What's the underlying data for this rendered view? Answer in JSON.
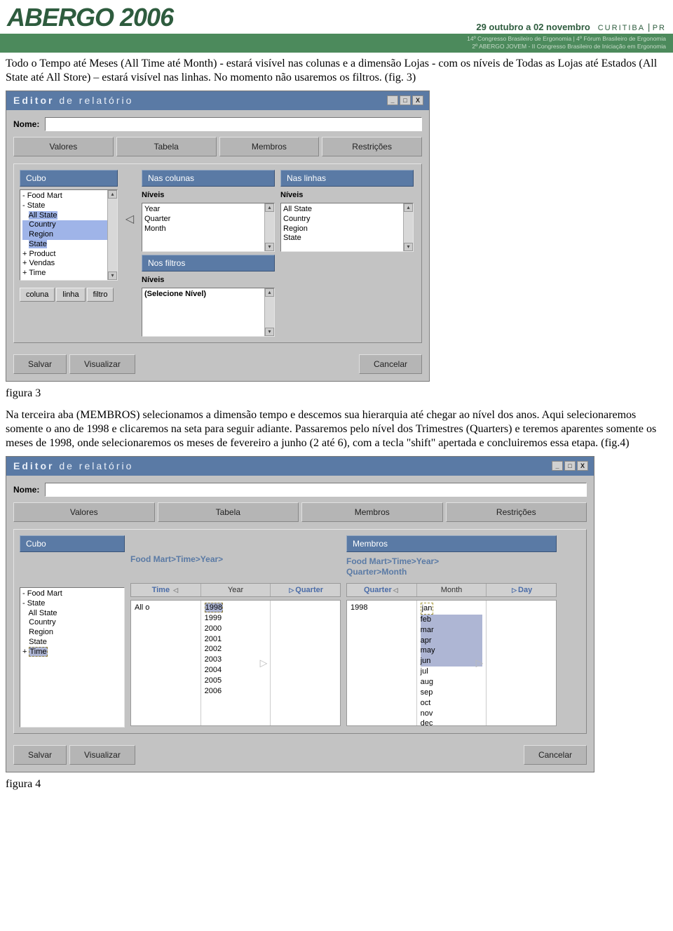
{
  "banner": {
    "title": "ABERGO 2006",
    "date_prefix": "29 outubro a 02 novembro",
    "city": "CURITIBA",
    "sep": "|",
    "state": "PR",
    "sub1": "14º Congresso Brasileiro de Ergonomia | 4º Fórum Brasileiro de Ergonomia",
    "sub2": "2º ABERGO JOVEM - II Congresso Brasileiro de Iniciação em Ergonomia"
  },
  "para1": "Todo o Tempo até Meses (All Time até Month) - estará visível nas colunas e a dimensão Lojas - com os níveis de Todas as Lojas até Estados (All State até All Store) – estará visível nas linhas. No momento não usaremos os filtros. (fig. 3)",
  "caption1": "figura 3",
  "para2": "Na terceira aba (MEMBROS) selecionamos a dimensão tempo e descemos sua hierarquia até chegar ao nível dos anos. Aqui selecionaremos somente o ano de 1998 e clicaremos na seta para seguir adiante. Passaremos pelo nível dos Trimestres (Quarters) e teremos aparentes somente os meses de 1998, onde selecionaremos os meses de fevereiro a junho (2 até 6), com a tecla \"shift\" apertada e concluiremos essa etapa. (fig.4)",
  "caption2": "figura 4",
  "editor": {
    "title_prefix": "Editor",
    "title_rest": " de relatório",
    "nome_label": "Nome:",
    "tabs": [
      "Valores",
      "Tabela",
      "Membros",
      "Restrições"
    ],
    "cube_header": "Cubo",
    "cols_header": "Nas colunas",
    "rows_header": "Nas linhas",
    "filters_header": "Nos filtros",
    "members_header": "Membros",
    "niveis": "Níveis",
    "tree": [
      "- Food Mart",
      "- State",
      "   All State",
      "   Country",
      "   Region",
      "   State",
      "+ Product",
      "+ Vendas",
      "+ Time"
    ],
    "tree2": [
      "- Food Mart",
      "- State",
      "   All State",
      "   Country",
      "   Region",
      "   State",
      "+ Time"
    ],
    "col_levels": [
      "Year",
      "Quarter",
      "Month"
    ],
    "row_levels": [
      "All State",
      "Country",
      "Region",
      "State"
    ],
    "filter_placeholder": "(Selecione Nível)",
    "small_btns": [
      "coluna",
      "linha",
      "filtro"
    ],
    "save": "Salvar",
    "view": "Visualizar",
    "cancel": "Cancelar",
    "bc1": "Food Mart>Time>Year>",
    "bc2a": "Food Mart>Time>Year>",
    "bc2b": "Quarter>Month",
    "nav1": [
      "Time",
      "Year",
      "Quarter"
    ],
    "nav2": [
      "Quarter",
      "Month",
      "Day"
    ],
    "allo": "All o",
    "years": [
      "1998",
      "1999",
      "2000",
      "2001",
      "2002",
      "2003",
      "2004",
      "2005",
      "2006"
    ],
    "y1998": "1998",
    "months": [
      "jan",
      "feb",
      "mar",
      "apr",
      "may",
      "jun",
      "jul",
      "aug",
      "sep",
      "oct",
      "nov",
      "dec"
    ]
  }
}
